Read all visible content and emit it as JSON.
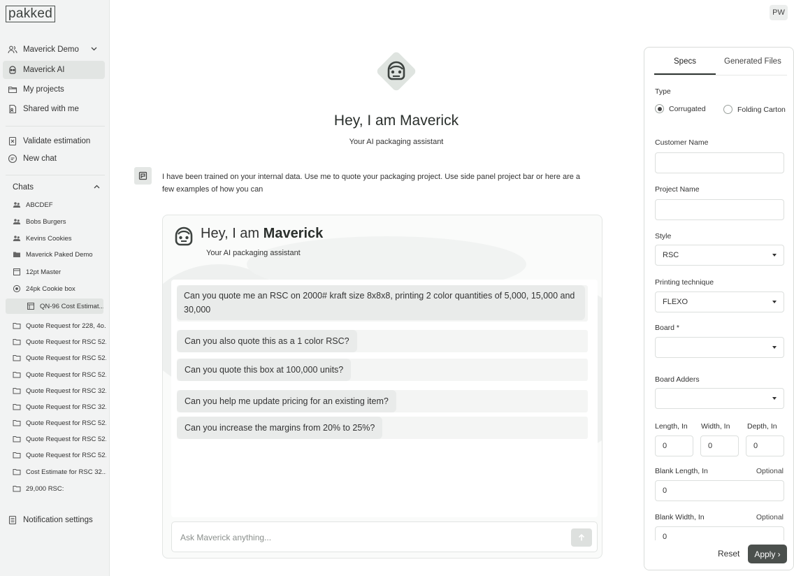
{
  "app": {
    "logo_text": "pakked",
    "user_initials": "PW"
  },
  "sidebar": {
    "workspace": {
      "label": "Maverick Demo"
    },
    "nav": [
      {
        "label": "Maverick AI",
        "icon": "robot-icon"
      },
      {
        "label": "My projects",
        "icon": "folder-icon"
      },
      {
        "label": "Shared with me",
        "icon": "shared-doc-icon"
      }
    ],
    "actions": [
      {
        "label": "Validate estimation",
        "icon": "validate-icon"
      },
      {
        "label": "New chat",
        "icon": "chat-icon"
      }
    ],
    "chats_header": "Chats",
    "chats": [
      {
        "label": "ABCDEF",
        "icon": "group-icon"
      },
      {
        "label": "Bobs Burgers",
        "icon": "group-icon"
      },
      {
        "label": "Kevins Cookies",
        "icon": "group-icon"
      },
      {
        "label": "Maverick Paked Demo",
        "icon": "folder-filled-icon"
      },
      {
        "label": "12pt Master",
        "icon": "table-icon"
      },
      {
        "label": "24pk Cookie box",
        "icon": "target-icon"
      },
      {
        "label": "QN-96 Cost Estimat...",
        "icon": "table-icon"
      },
      {
        "label": "Quote Request for 228, 4o...",
        "icon": "folder-icon"
      },
      {
        "label": "Quote Request for RSC 52...",
        "icon": "folder-icon"
      },
      {
        "label": "Quote Request for RSC 52...",
        "icon": "folder-icon"
      },
      {
        "label": "Quote Request for RSC 52...",
        "icon": "folder-icon"
      },
      {
        "label": "Quote Request for RSC 32...",
        "icon": "folder-icon"
      },
      {
        "label": "Quote Request for RSC 32...",
        "icon": "folder-icon"
      },
      {
        "label": "Quote Request for RSC 52...",
        "icon": "folder-icon"
      },
      {
        "label": "Quote Request for RSC 52...",
        "icon": "folder-icon"
      },
      {
        "label": "Quote Request for RSC 52...",
        "icon": "folder-icon"
      },
      {
        "label": "Cost Estimate for RSC 32...",
        "icon": "folder-icon"
      },
      {
        "label": "29,000 RSC:",
        "icon": "folder-icon"
      }
    ],
    "notification_settings": "Notification settings"
  },
  "main": {
    "title": "Hey, I am Maverick",
    "subtitle": "Your AI packaging assistant",
    "intro": "I have been trained on your internal data. Use me to quote your packaging project.  Use side panel project bar or here are a few examples of how you can",
    "panel": {
      "title_prefix": "Hey, I am ",
      "title_name": "Maverick",
      "subtitle": "Your AI packaging assistant",
      "suggestions": [
        "Can you quote me an RSC on 2000# kraft size 8x8x8, printing 2 color quantities of 5,000, 15,000 and 30,000",
        "Can you also quote this as a 1 color RSC?",
        "Can you quote this box at 100,000 units?",
        "Can you help me update pricing for an existing item?",
        "Can you increase the margins from 20% to 25%?"
      ]
    },
    "composer": {
      "placeholder": "Ask Maverick anything..."
    }
  },
  "right_panel": {
    "tabs": [
      "Specs",
      "Generated Files"
    ],
    "type_label": "Type",
    "type_options": [
      "Corrugated",
      "Folding Carton"
    ],
    "type_selected": "Corrugated",
    "customer_name_label": "Customer Name",
    "customer_name_value": "",
    "project_name_label": "Project Name",
    "project_name_value": "",
    "style_label": "Style",
    "style_value": "RSC",
    "printing_label": "Printing technique",
    "printing_value": "FLEXO",
    "board_label": "Board *",
    "board_value": "",
    "board_adders_label": "Board Adders",
    "board_adders_value": "",
    "length_label": "Length, In",
    "length_value": "0",
    "width_label": "Width, In",
    "width_value": "0",
    "depth_label": "Depth, In",
    "depth_value": "0",
    "blank_length_label": "Blank Length, In",
    "blank_length_value": "0",
    "blank_width_label": "Blank Width, In",
    "blank_width_value": "0",
    "optional_label": "Optional",
    "reset_label": "Reset",
    "apply_label": "Apply ›"
  }
}
